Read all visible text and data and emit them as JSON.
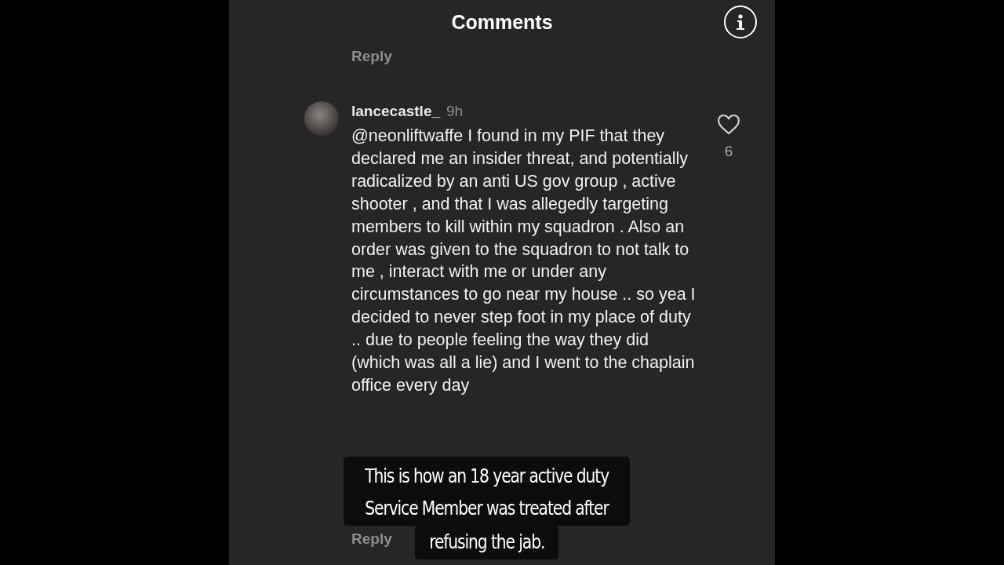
{
  "header": {
    "title": "Comments"
  },
  "previous_reply": {
    "label": "Reply"
  },
  "comment": {
    "username": "lancecastle_",
    "time": "9h",
    "text": "@neonliftwaffe I found in my PIF that they declared me an insider threat, and potentially radicalized by an anti US gov group , active shooter , and that I was allegedly targeting members to kill within my squadron . Also an order was given to the squadron to not talk to me , interact with me or under any circumstances to go near my house .. so yea I decided to never step foot in my place of duty .. due to people feeling the way they did (which was all a lie) and I went to the chaplain office every day",
    "likes": "6",
    "liked": false,
    "reply": "Reply"
  },
  "caption": {
    "lines": [
      "This is how an 18 year active duty",
      "Service Member was treated after",
      "refusing the jab."
    ]
  }
}
